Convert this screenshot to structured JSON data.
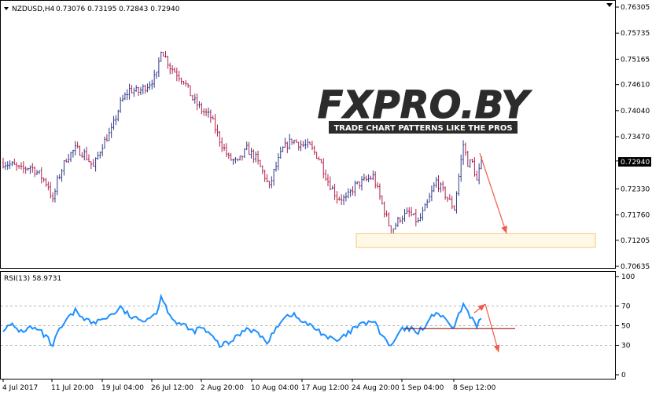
{
  "chart_data": [
    {
      "type": "candlestick",
      "symbol_label": "NZDUSD,H4",
      "ohlc_label": "0.73076 0.73195 0.72843 0.72940",
      "current_price": "0.72940",
      "ylim": [
        0.70635,
        0.76305
      ],
      "price_ticks": [
        "0.76305",
        "0.75735",
        "0.75165",
        "0.74610",
        "0.74040",
        "0.73470",
        "0.72940",
        "0.72330",
        "0.71760",
        "0.71205",
        "0.70635"
      ],
      "x_ticks": [
        "4 Jul 2017",
        "11 Jul 20:00",
        "19 Jul 04:00",
        "26 Jul 12:00",
        "2 Aug 20:00",
        "10 Aug 04:00",
        "17 Aug 12:00",
        "24 Aug 20:00",
        "1 Sep 04:00",
        "8 Sep 12:00"
      ],
      "watermark": {
        "brand": "FXPRO.BY",
        "tagline": "TRADE CHART PATTERNS LIKE THE PROS"
      },
      "target_zone": [
        0.7105,
        0.7135
      ],
      "approx_path": [
        [
          0,
          0.729
        ],
        [
          4,
          0.7285
        ],
        [
          8,
          0.7275
        ],
        [
          12,
          0.7282
        ],
        [
          16,
          0.7265
        ],
        [
          20,
          0.724
        ],
        [
          22,
          0.7205
        ],
        [
          24,
          0.725
        ],
        [
          28,
          0.73
        ],
        [
          32,
          0.732
        ],
        [
          36,
          0.731
        ],
        [
          40,
          0.728
        ],
        [
          44,
          0.733
        ],
        [
          48,
          0.736
        ],
        [
          52,
          0.742
        ],
        [
          56,
          0.745
        ],
        [
          60,
          0.7445
        ],
        [
          64,
          0.746
        ],
        [
          68,
          0.748
        ],
        [
          70,
          0.754
        ],
        [
          72,
          0.752
        ],
        [
          74,
          0.75
        ],
        [
          76,
          0.749
        ],
        [
          80,
          0.747
        ],
        [
          84,
          0.743
        ],
        [
          88,
          0.7405
        ],
        [
          92,
          0.739
        ],
        [
          96,
          0.734
        ],
        [
          100,
          0.73
        ],
        [
          104,
          0.729
        ],
        [
          108,
          0.732
        ],
        [
          112,
          0.73
        ],
        [
          116,
          0.726
        ],
        [
          118,
          0.7235
        ],
        [
          120,
          0.727
        ],
        [
          124,
          0.732
        ],
        [
          128,
          0.734
        ],
        [
          132,
          0.733
        ],
        [
          136,
          0.7325
        ],
        [
          140,
          0.73
        ],
        [
          144,
          0.725
        ],
        [
          148,
          0.7215
        ],
        [
          152,
          0.721
        ],
        [
          156,
          0.724
        ],
        [
          160,
          0.725
        ],
        [
          164,
          0.726
        ],
        [
          168,
          0.72
        ],
        [
          172,
          0.714
        ],
        [
          176,
          0.717
        ],
        [
          180,
          0.718
        ],
        [
          184,
          0.716
        ],
        [
          188,
          0.72
        ],
        [
          192,
          0.725
        ],
        [
          196,
          0.722
        ],
        [
          200,
          0.719
        ],
        [
          204,
          0.733
        ],
        [
          206,
          0.729
        ],
        [
          208,
          0.729
        ],
        [
          210,
          0.725
        ],
        [
          212,
          0.7294
        ]
      ]
    },
    {
      "type": "line",
      "indicator_label": "RSI(13) 58.9731",
      "ylim": [
        0,
        100
      ],
      "y_ticks": [
        "100",
        "70",
        "50",
        "30",
        "0"
      ],
      "levels": [
        70,
        50,
        30
      ],
      "approx_path": [
        [
          0,
          47
        ],
        [
          4,
          50
        ],
        [
          8,
          44
        ],
        [
          12,
          48
        ],
        [
          16,
          45
        ],
        [
          20,
          36
        ],
        [
          22,
          28
        ],
        [
          24,
          42
        ],
        [
          28,
          55
        ],
        [
          32,
          65
        ],
        [
          36,
          58
        ],
        [
          40,
          52
        ],
        [
          44,
          57
        ],
        [
          48,
          61
        ],
        [
          52,
          68
        ],
        [
          56,
          60
        ],
        [
          60,
          55
        ],
        [
          64,
          58
        ],
        [
          68,
          63
        ],
        [
          70,
          80
        ],
        [
          72,
          70
        ],
        [
          74,
          62
        ],
        [
          76,
          55
        ],
        [
          80,
          50
        ],
        [
          84,
          44
        ],
        [
          88,
          48
        ],
        [
          92,
          40
        ],
        [
          96,
          30
        ],
        [
          100,
          32
        ],
        [
          104,
          40
        ],
        [
          108,
          48
        ],
        [
          112,
          44
        ],
        [
          116,
          35
        ],
        [
          118,
          33
        ],
        [
          120,
          45
        ],
        [
          124,
          58
        ],
        [
          128,
          62
        ],
        [
          132,
          55
        ],
        [
          136,
          50
        ],
        [
          140,
          45
        ],
        [
          144,
          38
        ],
        [
          148,
          34
        ],
        [
          152,
          40
        ],
        [
          156,
          48
        ],
        [
          160,
          52
        ],
        [
          164,
          55
        ],
        [
          168,
          40
        ],
        [
          172,
          28
        ],
        [
          176,
          45
        ],
        [
          180,
          47
        ],
        [
          184,
          44
        ],
        [
          188,
          52
        ],
        [
          192,
          65
        ],
        [
          196,
          55
        ],
        [
          200,
          48
        ],
        [
          204,
          72
        ],
        [
          206,
          62
        ],
        [
          208,
          58
        ],
        [
          210,
          50
        ],
        [
          212,
          59
        ]
      ]
    }
  ]
}
